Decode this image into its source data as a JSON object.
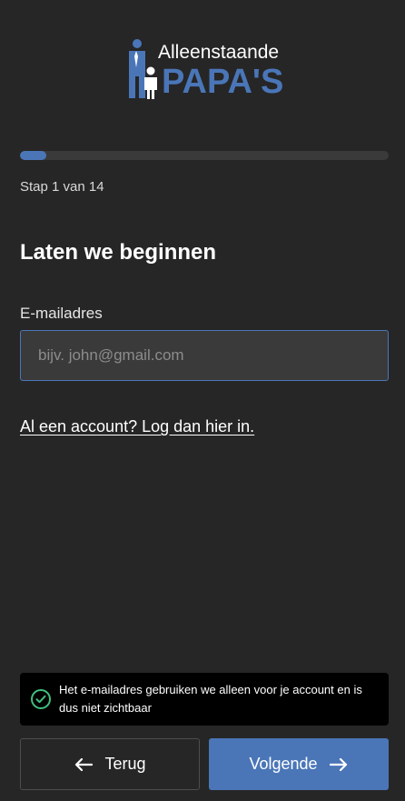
{
  "brand": {
    "logo_line1": "Alleenstaande",
    "logo_line2": "PAPA'S",
    "color": "#4a76b8"
  },
  "progress": {
    "current_step": 1,
    "total_steps": 14,
    "fraction": 0.0714,
    "step_label": "Stap 1 van 14"
  },
  "form": {
    "title": "Laten we beginnen",
    "email_label": "E-mailadres",
    "email_placeholder": "bijv. john@gmail.com",
    "email_value": "",
    "login_link": "Al een account? Log dan hier in."
  },
  "notice": {
    "icon": "check-circle-icon",
    "text": "Het e-mailadres gebruiken we alleen voor je account en is dus niet zichtbaar",
    "icon_color": "#3fbf7f"
  },
  "buttons": {
    "back_label": "Terug",
    "back_icon": "arrow-left-icon",
    "next_label": "Volgende",
    "next_icon": "arrow-right-icon"
  }
}
